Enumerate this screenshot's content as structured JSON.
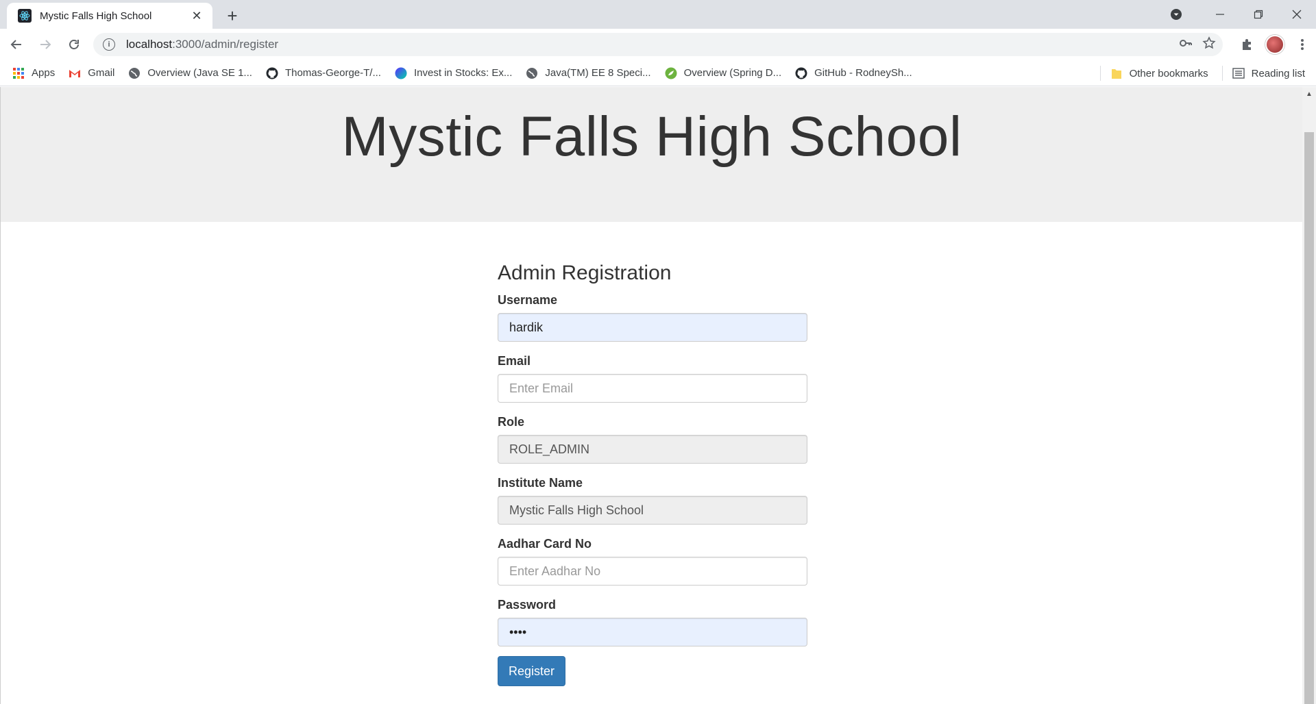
{
  "browser": {
    "tab_title": "Mystic Falls High School",
    "url_host": "localhost",
    "url_path": ":3000/admin/register",
    "bookmarks": [
      {
        "label": "Apps",
        "icon": "apps-grid-icon"
      },
      {
        "label": "Gmail",
        "icon": "gmail-icon"
      },
      {
        "label": "Overview (Java SE 1...",
        "icon": "globe-icon"
      },
      {
        "label": "Thomas-George-T/...",
        "icon": "github-icon"
      },
      {
        "label": "Invest in Stocks: Ex...",
        "icon": "stocks-icon"
      },
      {
        "label": "Java(TM) EE 8 Speci...",
        "icon": "globe-icon"
      },
      {
        "label": "Overview (Spring D...",
        "icon": "spring-icon"
      },
      {
        "label": "GitHub - RodneySh...",
        "icon": "github-icon"
      }
    ],
    "other_bookmarks": "Other bookmarks",
    "reading_list": "Reading list"
  },
  "page": {
    "header_title": "Mystic Falls High School",
    "form_title": "Admin Registration",
    "fields": {
      "username": {
        "label": "Username",
        "value": "hardik"
      },
      "email": {
        "label": "Email",
        "placeholder": "Enter Email"
      },
      "role": {
        "label": "Role",
        "value": "ROLE_ADMIN"
      },
      "institute": {
        "label": "Institute Name",
        "value": "Mystic Falls High School"
      },
      "aadhar": {
        "label": "Aadhar Card No",
        "placeholder": "Enter Aadhar No"
      },
      "password": {
        "label": "Password",
        "value": "••••"
      }
    },
    "submit_label": "Register"
  },
  "colors": {
    "primary_button": "#337ab7",
    "jumbotron_bg": "#eeeeee",
    "autofill_bg": "#e8f0fe"
  }
}
